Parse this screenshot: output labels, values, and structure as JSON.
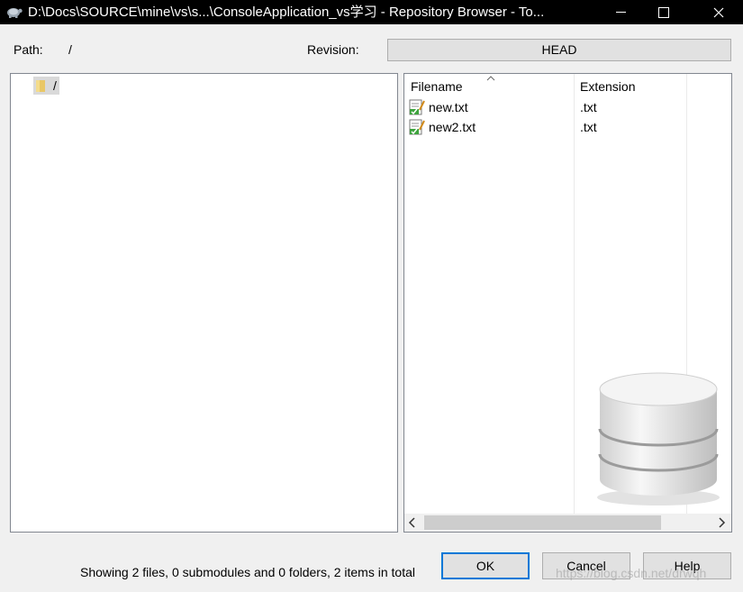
{
  "window": {
    "title": "D:\\Docs\\SOURCE\\mine\\vs\\s...\\ConsoleApplication_vs学习 - Repository Browser - To...",
    "minimize_symbol": "—",
    "close_symbol": "✕"
  },
  "path": {
    "label": "Path:",
    "value": "/"
  },
  "revision": {
    "label": "Revision:",
    "value": "HEAD"
  },
  "tree": {
    "root_label": "/"
  },
  "file_list": {
    "columns": [
      "Filename",
      "Extension"
    ],
    "sorted_by": "Filename",
    "rows": [
      {
        "name": "new.txt",
        "extension": ".txt"
      },
      {
        "name": "new2.txt",
        "extension": ".txt"
      }
    ]
  },
  "status_text": "Showing 2 files, 0 submodules and 0 folders, 2 items in total",
  "buttons": {
    "ok": "OK",
    "cancel": "Cancel",
    "help": "Help"
  },
  "watermark": "https://blog.csdn.net/drwqh",
  "colors": {
    "titlebar_bg": "#000000",
    "default_button_border": "#0078d7",
    "window_bg": "#f0f0f0"
  }
}
